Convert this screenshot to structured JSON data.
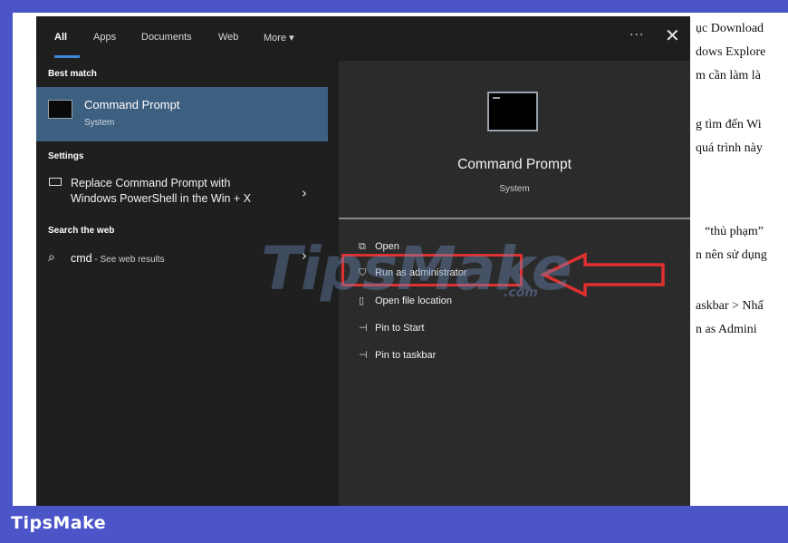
{
  "tabs": [
    {
      "label": "All",
      "active": true
    },
    {
      "label": "Apps"
    },
    {
      "label": "Documents"
    },
    {
      "label": "Web"
    },
    {
      "label": "More ▾"
    }
  ],
  "header_actions": {
    "more_dots": "···",
    "close": "✕"
  },
  "sections": {
    "best_match": "Best match",
    "settings": "Settings",
    "search_web": "Search the web"
  },
  "best_match": {
    "title": "Command Prompt",
    "subtitle": "System",
    "icon": "command-prompt-icon"
  },
  "settings_item": {
    "line1": "Replace Command Prompt with",
    "line2": "Windows PowerShell in the Win + X",
    "icon": "monitor-icon"
  },
  "web_item": {
    "query": "cmd",
    "suffix": " - See web results",
    "icon": "search-icon"
  },
  "detail": {
    "title": "Command Prompt",
    "subtitle": "System"
  },
  "actions": [
    {
      "label": "Open",
      "icon": "open-icon"
    },
    {
      "label": "Run as administrator",
      "icon": "shield-icon"
    },
    {
      "label": "Open file location",
      "icon": "folder-icon"
    },
    {
      "label": "Pin to Start",
      "icon": "pin-icon"
    },
    {
      "label": "Pin to taskbar",
      "icon": "pin-icon"
    }
  ],
  "watermark": {
    "main": "TipsMake",
    "suffix": ".com"
  },
  "footer_brand": "TipsMake",
  "background_text": [
    "ục Download",
    "dows Explore",
    "m cần làm là",
    "g tìm đến Wi",
    "quá trình này",
    "“thủ phạm”",
    "n nên sử dụng",
    "askbar > Nhấ",
    "n as Admini"
  ],
  "colors": {
    "frame": "#4b55c8",
    "selection": "#3d5f80",
    "highlight": "#e03030"
  }
}
